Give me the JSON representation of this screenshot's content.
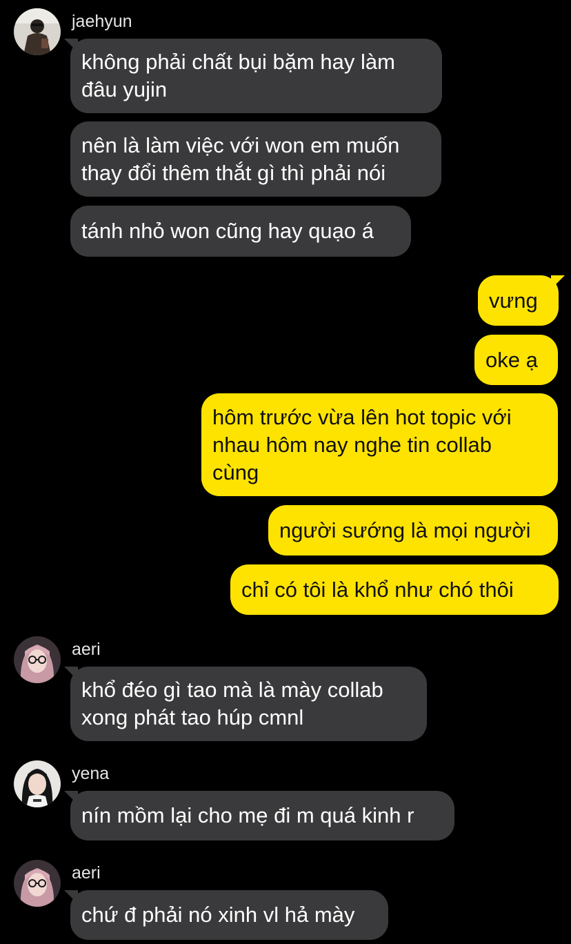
{
  "messages": [
    {
      "id": 1,
      "side": "in",
      "sender": "jaehyun",
      "text": "không phải chất bụi bặm hay làm\nđâu yujin"
    },
    {
      "id": 2,
      "side": "in",
      "text": "nên là làm việc với won em muốn\nthay đổi thêm thắt gì thì phải nói"
    },
    {
      "id": 3,
      "side": "in",
      "text": "tánh nhỏ won cũng hay quạo á"
    },
    {
      "id": 4,
      "side": "out",
      "text": "vưng"
    },
    {
      "id": 5,
      "side": "out",
      "text": "oke ạ"
    },
    {
      "id": 6,
      "side": "out",
      "text": "hôm trước vừa lên hot topic với\nnhau hôm nay nghe tin collab\ncùng"
    },
    {
      "id": 7,
      "side": "out",
      "text": "người sướng là mọi người"
    },
    {
      "id": 8,
      "side": "out",
      "text": "chỉ có tôi là khổ như chó thôi"
    },
    {
      "id": 9,
      "side": "in",
      "sender": "aeri",
      "text": "khổ đéo gì tao mà là mày collab\nxong phát tao húp cmnl"
    },
    {
      "id": 10,
      "side": "in",
      "sender": "yena",
      "text": "nín mồm lại cho mẹ đi m quá kinh r"
    },
    {
      "id": 11,
      "side": "in",
      "sender": "aeri",
      "text": "chứ đ phải nó xinh vl hả mày"
    }
  ],
  "colors": {
    "background": "#000000",
    "incoming_bubble": "#3a3a3c",
    "outgoing_bubble": "#ffe300",
    "incoming_text": "#ffffff",
    "outgoing_text": "#111111"
  }
}
